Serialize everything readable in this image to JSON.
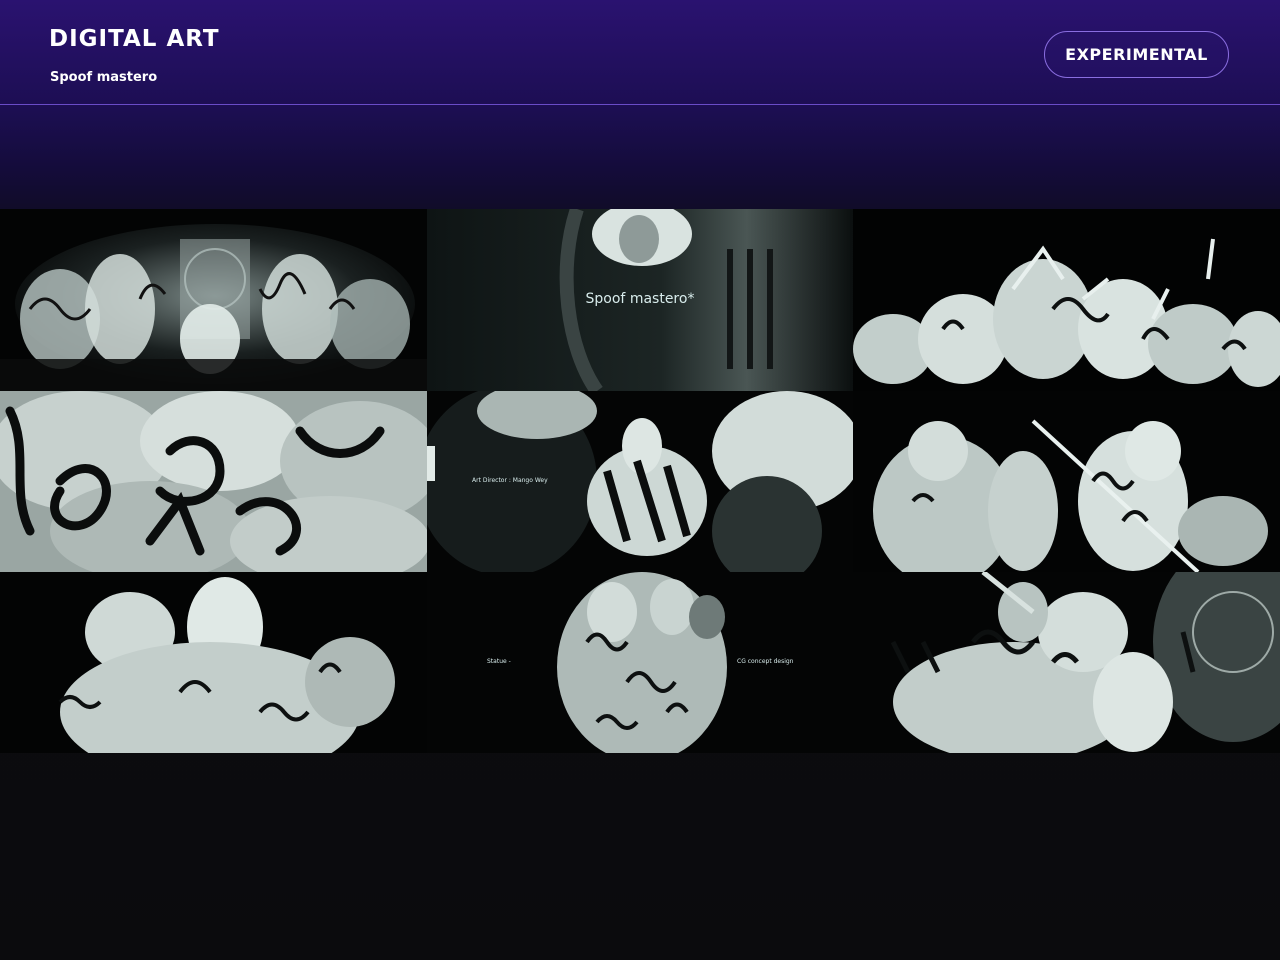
{
  "header": {
    "title": "DIGITAL ART",
    "subtitle": "Spoof mastero",
    "tag_label": "EXPERIMENTAL"
  },
  "gallery": {
    "overlays": {
      "tile2_title": "Spoof mastero*",
      "tile5_credit": "Art Director : Mango Wey",
      "tile8_left": "Statue -",
      "tile8_right": "CG concept design"
    }
  },
  "colors": {
    "header_purple": "#2a1270",
    "accent_line": "#6a4cc8",
    "background": "#0b0b0d",
    "statue_tone": "#c9d6d3"
  }
}
